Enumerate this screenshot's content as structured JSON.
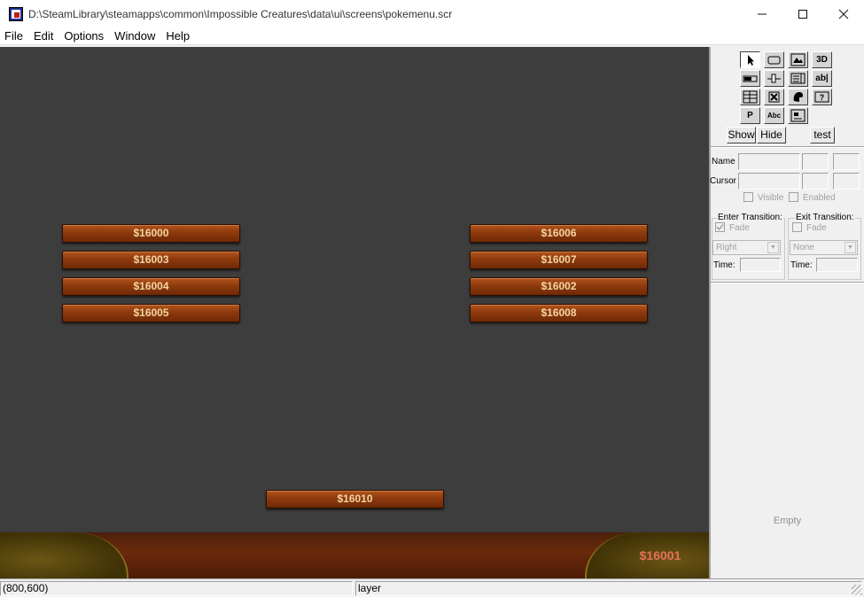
{
  "window": {
    "title": "D:\\SteamLibrary\\steamapps\\common\\Impossible Creatures\\data\\ui\\screens\\pokemenu.scr"
  },
  "menu": [
    "File",
    "Edit",
    "Options",
    "Window",
    "Help"
  ],
  "canvas": {
    "left_buttons": [
      "$16000",
      "$16003",
      "$16004",
      "$16005"
    ],
    "right_buttons": [
      "$16006",
      "$16007",
      "$16002",
      "$16008"
    ],
    "center_button": "$16010",
    "bottom_label": "$16001"
  },
  "panel": {
    "tool_labels": {
      "frame3d": "3D",
      "textedit": "ab|",
      "picture": "P",
      "textabc": "Abc"
    },
    "show_label": "Show",
    "hide_label": "Hide",
    "test_label": "test",
    "name_label": "Name",
    "cursor_label": "Cursor",
    "visible_label": "Visible",
    "enabled_label": "Enabled",
    "enter_transition": {
      "title": "Enter Transition:",
      "fade_label": "Fade",
      "fade_checked": true,
      "type": "Right",
      "time_label": "Time:"
    },
    "exit_transition": {
      "title": "Exit Transition:",
      "fade_label": "Fade",
      "fade_checked": false,
      "type": "None",
      "time_label": "Time:"
    },
    "empty_label": "Empty"
  },
  "status": {
    "coords": "(800,600)",
    "layer": "layer"
  }
}
